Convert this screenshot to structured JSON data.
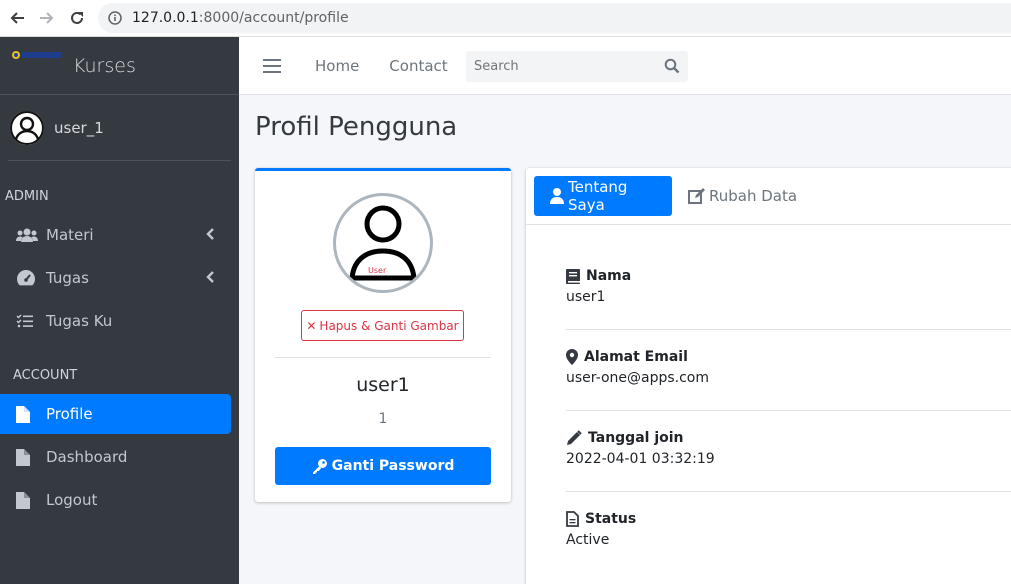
{
  "browser": {
    "url_host": "127.0.0.1",
    "url_rest": ":8000/account/profile"
  },
  "sidebar": {
    "brand": "Kurses",
    "user": "user_1",
    "sections": [
      {
        "header": "ADMIN"
      },
      {
        "header": "ACCOUNT"
      }
    ],
    "items": [
      {
        "label": "Materi",
        "icon": "users-icon"
      },
      {
        "label": "Tugas",
        "icon": "gauge-icon"
      },
      {
        "label": "Tugas Ku",
        "icon": "tasks-icon"
      },
      {
        "label": "Profile",
        "icon": "file-icon"
      },
      {
        "label": "Dashboard",
        "icon": "file-icon"
      },
      {
        "label": "Logout",
        "icon": "file-icon"
      }
    ],
    "active": "Profile"
  },
  "navbar": {
    "links": [
      "Home",
      "Contact"
    ],
    "search_placeholder": "Search"
  },
  "page": {
    "title": "Profil Pengguna"
  },
  "profile": {
    "avatar_tag": "User",
    "remove_button": "Hapus & Ganti Gambar",
    "username": "user1",
    "id": "1",
    "change_password_button": "Ganti Password"
  },
  "detail": {
    "tabs": [
      "Tentang Saya",
      "Rubah Data"
    ],
    "fields": [
      {
        "label": "Nama",
        "value": "user1",
        "icon": "book-icon"
      },
      {
        "label": "Alamat Email",
        "value": "user-one@apps.com",
        "icon": "map-marker-icon"
      },
      {
        "label": "Tanggal join",
        "value": "2022-04-01 03:32:19",
        "icon": "pencil-icon"
      },
      {
        "label": "Status",
        "value": "Active",
        "icon": "file-text-icon"
      }
    ]
  },
  "colors": {
    "primary": "#007bff",
    "sidebar_bg": "#343a40",
    "danger": "#dc3545"
  }
}
